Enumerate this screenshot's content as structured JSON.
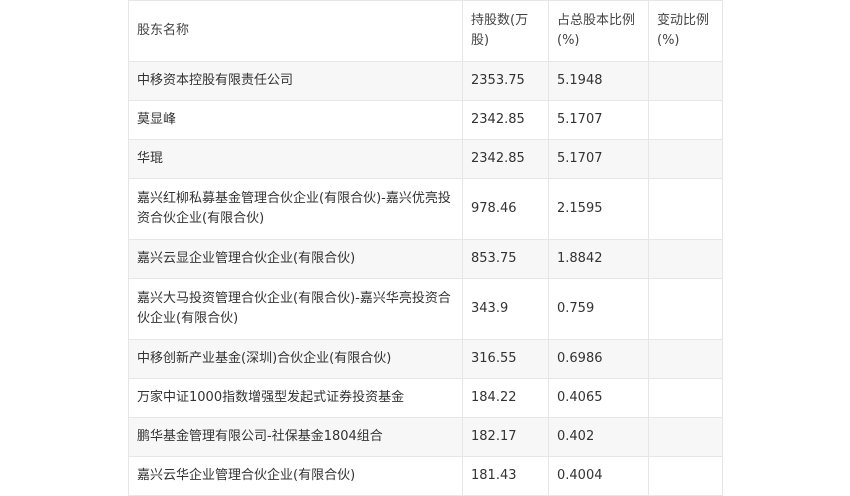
{
  "table": {
    "headers": [
      "股东名称",
      "持股数(万股)",
      "占总股本比例(%)",
      "变动比例(%)"
    ],
    "rows": [
      {
        "name": "中移资本控股有限责任公司",
        "shares": "2353.75",
        "ratio": "5.1948",
        "change": ""
      },
      {
        "name": "莫显峰",
        "shares": "2342.85",
        "ratio": "5.1707",
        "change": ""
      },
      {
        "name": "华琨",
        "shares": "2342.85",
        "ratio": "5.1707",
        "change": ""
      },
      {
        "name": "嘉兴红柳私募基金管理合伙企业(有限合伙)-嘉兴优亮投资合伙企业(有限合伙)",
        "shares": "978.46",
        "ratio": "2.1595",
        "change": ""
      },
      {
        "name": "嘉兴云显企业管理合伙企业(有限合伙)",
        "shares": "853.75",
        "ratio": "1.8842",
        "change": ""
      },
      {
        "name": "嘉兴大马投资管理合伙企业(有限合伙)-嘉兴华亮投资合伙企业(有限合伙)",
        "shares": "343.9",
        "ratio": "0.759",
        "change": ""
      },
      {
        "name": "中移创新产业基金(深圳)合伙企业(有限合伙)",
        "shares": "316.55",
        "ratio": "0.6986",
        "change": ""
      },
      {
        "name": "万家中证1000指数增强型发起式证券投资基金",
        "shares": "184.22",
        "ratio": "0.4065",
        "change": ""
      },
      {
        "name": "鹏华基金管理有限公司-社保基金1804组合",
        "shares": "182.17",
        "ratio": "0.402",
        "change": ""
      },
      {
        "name": "嘉兴云华企业管理合伙企业(有限合伙)",
        "shares": "181.43",
        "ratio": "0.4004",
        "change": ""
      }
    ]
  }
}
